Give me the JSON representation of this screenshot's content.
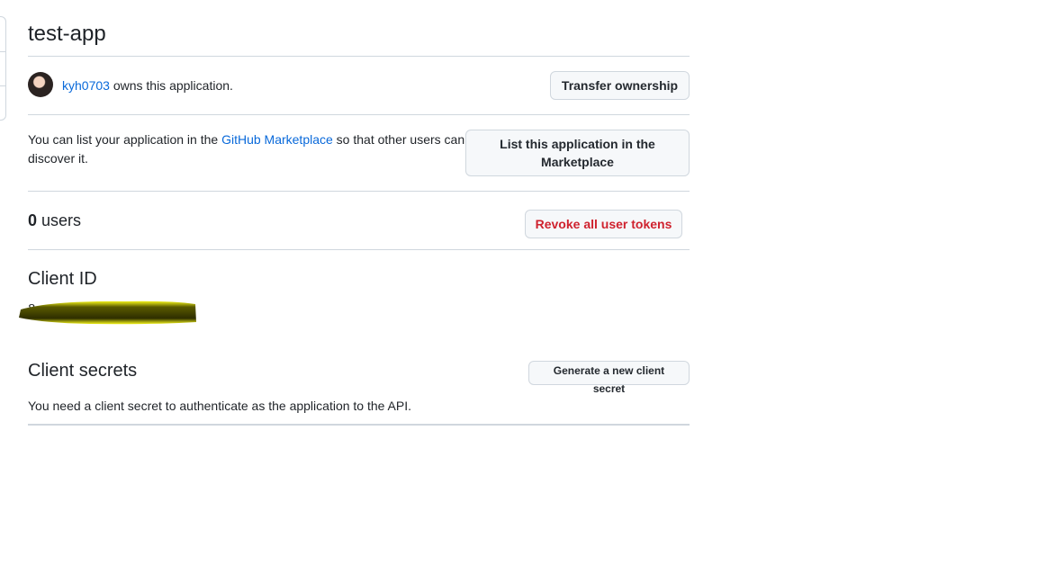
{
  "app": {
    "title": "test-app"
  },
  "owner": {
    "username": "kyh0703",
    "suffix": " owns this application.",
    "transfer_label": "Transfer ownership"
  },
  "marketplace": {
    "text_before": "You can list your application in the ",
    "link": "GitHub Marketplace",
    "text_after": " so that other users can discover it.",
    "button_line1": "List this application in the",
    "button_line2": "Marketplace"
  },
  "users": {
    "count": "0",
    "label": " users",
    "revoke_label": "Revoke all user tokens"
  },
  "client_id": {
    "heading": "Client ID",
    "value_partial": "8"
  },
  "client_secrets": {
    "heading": "Client secrets",
    "generate_label": "Generate a new client secret",
    "description": "You need a client secret to authenticate as the application to the API."
  },
  "colors": {
    "link": "#0969da",
    "danger": "#cf222e",
    "redaction": "#e6e600"
  }
}
